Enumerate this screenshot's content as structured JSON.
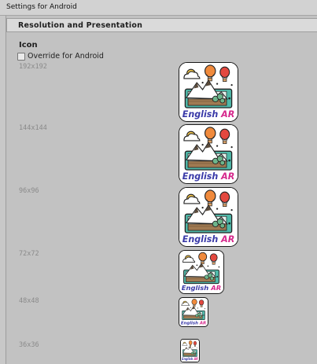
{
  "window": {
    "title": "Settings for Android"
  },
  "section": {
    "title": "Resolution and Presentation"
  },
  "icon_group": {
    "title": "Icon",
    "override_label": "Override for Android",
    "override_checked": false
  },
  "icons": [
    {
      "size_label": "192x192"
    },
    {
      "size_label": "144x144"
    },
    {
      "size_label": "96x96"
    },
    {
      "size_label": "72x72"
    },
    {
      "size_label": "48x48"
    },
    {
      "size_label": "36x36"
    }
  ],
  "app_icon": {
    "caption_left": "English",
    "caption_right": "AR",
    "colors": {
      "caption_left": "#3a3aa8",
      "caption_right": "#d6288c",
      "balloon_orange": "#f08a3c",
      "balloon_red": "#e3483f",
      "tablet": "#4fb9a9",
      "mountain": "#5a4a3a"
    }
  }
}
